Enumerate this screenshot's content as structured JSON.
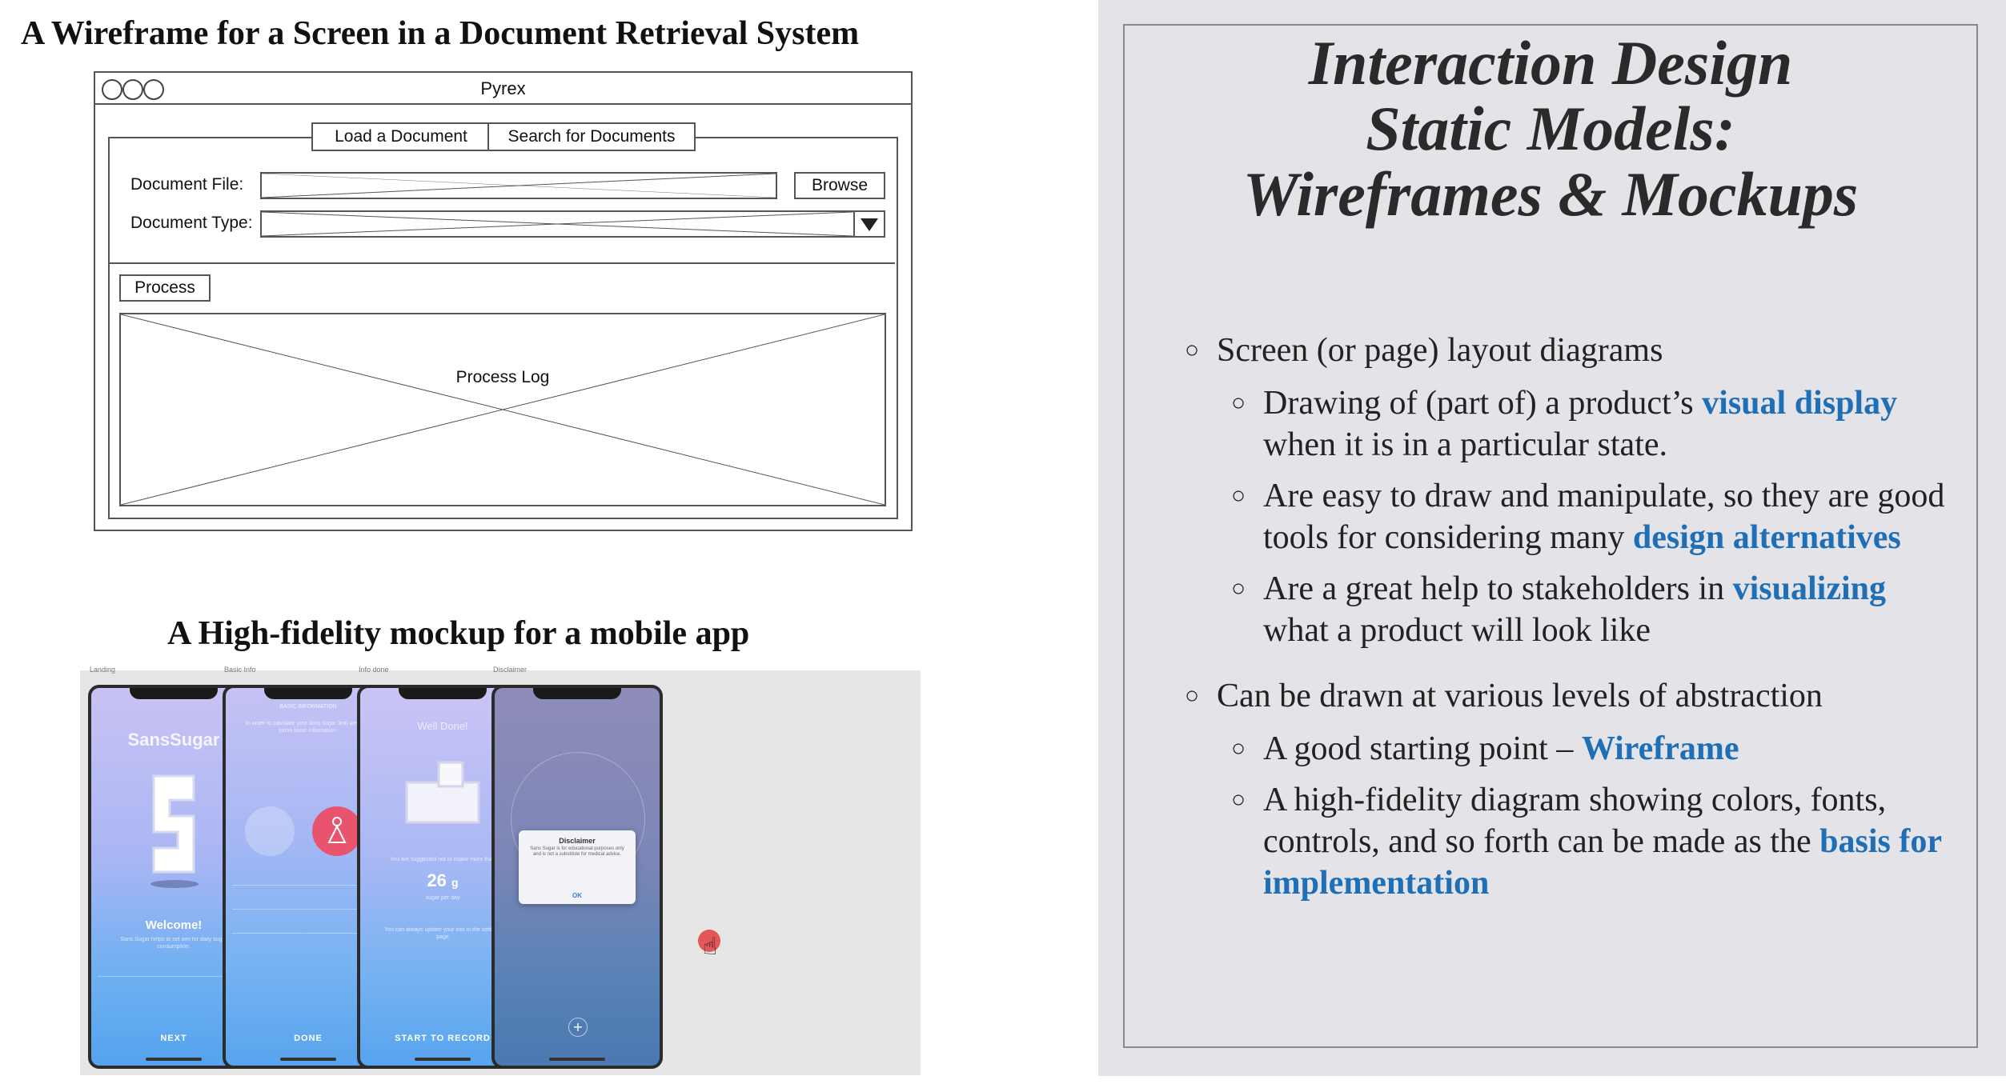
{
  "left": {
    "wireframe_heading": "A Wireframe for a Screen in a Document Retrieval System",
    "mockup_heading": "A High-fidelity mockup for a mobile app"
  },
  "wireframe": {
    "window_title": "Pyrex",
    "tabs": [
      "Load a Document",
      "Search for Documents"
    ],
    "document_file_label": "Document File:",
    "document_type_label": "Document Type:",
    "browse_button": "Browse",
    "process_button": "Process",
    "process_log_label": "Process Log"
  },
  "mockup": {
    "screens": [
      {
        "caption": "Landing",
        "app_name": "SansSugar",
        "welcome": "Welcome!",
        "cta": "NEXT"
      },
      {
        "caption": "Basic Info",
        "header": "BASIC INFORMATION",
        "cta": "DONE"
      },
      {
        "caption": "Info done",
        "header": "Well Done!",
        "value": "26",
        "unit": "g",
        "cta": "START TO RECORD"
      },
      {
        "caption": "Disclaimer",
        "dialog_title": "Disclaimer",
        "dialog_ok": "OK"
      }
    ],
    "colors": {
      "phone_top": "#c8c4f5",
      "phone_bottom": "#5ea8f0",
      "accent_pink": "#e8546e"
    }
  },
  "right": {
    "title_lines": [
      "Interaction Design",
      "Static Models:",
      "Wireframes & Mockups"
    ],
    "bullets": {
      "b1": "Screen (or page) layout diagrams",
      "b1_s1_pre": "Drawing of (part of) a product’s ",
      "b1_s1_hl": "visual display",
      "b1_s1_post": " when it is in a particular state.",
      "b1_s2_pre": "Are easy to draw and manipulate, so they are good tools for considering many ",
      "b1_s2_hl": "design alternatives",
      "b1_s3_pre": "Are a great help to stakeholders in ",
      "b1_s3_hl": "visualizing",
      "b1_s3_post": " what a product will look like",
      "b2": "Can be drawn at various levels of abstraction",
      "b2_s1_pre": "A good starting point – ",
      "b2_s1_hl": "Wireframe",
      "b2_s2_pre": "A high-fidelity diagram showing colors, fonts, controls, and so forth can be made as the ",
      "b2_s2_hl": "basis for implementation"
    },
    "highlight_color": "#1f6fb7"
  }
}
